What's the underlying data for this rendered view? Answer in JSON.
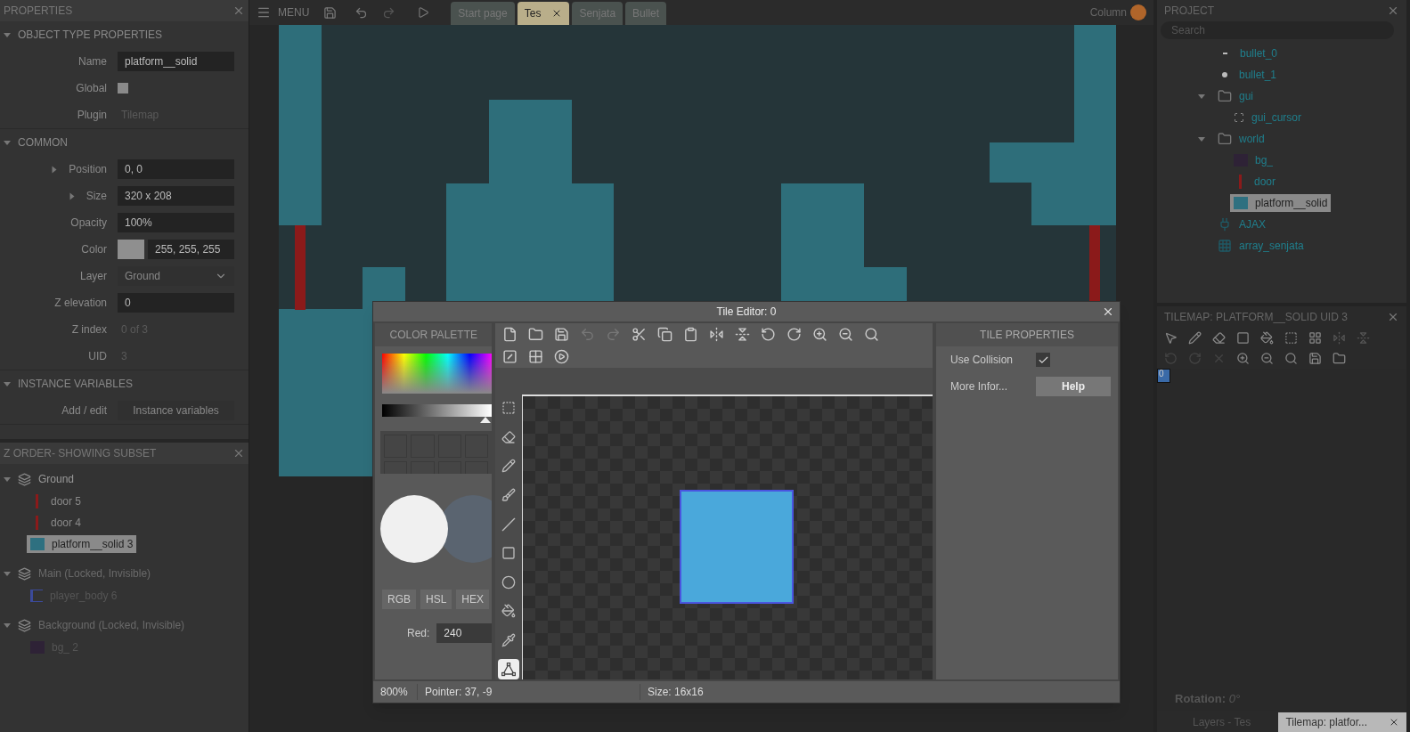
{
  "top_bar": {
    "menu": "MENU",
    "tabs": [
      {
        "label": "Start page",
        "selected": false,
        "closable": false
      },
      {
        "label": "Tes",
        "selected": true,
        "closable": true
      },
      {
        "label": "Senjata",
        "selected": false,
        "closable": false
      },
      {
        "label": "Bullet",
        "selected": false,
        "closable": false
      }
    ],
    "user": "Column"
  },
  "properties_panel": {
    "title": "PROPERTIES",
    "sections": [
      {
        "title": "OBJECT TYPE PROPERTIES",
        "expanded": true,
        "rows": [
          {
            "kind": "text",
            "label": "Name",
            "value": "platform__solid"
          },
          {
            "kind": "checkbox",
            "label": "Global",
            "checked": false
          },
          {
            "kind": "readonly",
            "label": "Plugin",
            "value": "Tilemap"
          }
        ]
      },
      {
        "title": "COMMON",
        "expanded": true,
        "rows": [
          {
            "kind": "group",
            "label": "Position",
            "value": "0, 0"
          },
          {
            "kind": "group",
            "label": "Size",
            "value": "320 x 208"
          },
          {
            "kind": "text",
            "label": "Opacity",
            "value": "100%"
          },
          {
            "kind": "color",
            "label": "Color",
            "value": "255, 255, 255"
          },
          {
            "kind": "select",
            "label": "Layer",
            "value": "Ground"
          },
          {
            "kind": "text",
            "label": "Z elevation",
            "value": "0"
          },
          {
            "kind": "readonly",
            "label": "Z index",
            "value": "0 of 3"
          },
          {
            "kind": "readonly",
            "label": "UID",
            "value": "3"
          }
        ]
      },
      {
        "title": "INSTANCE VARIABLES",
        "expanded": true,
        "rows": [
          {
            "kind": "button",
            "label": "Add / edit",
            "value": "Instance variables"
          }
        ]
      }
    ]
  },
  "z_order": {
    "title": "Z ORDER- SHOWING SUBSET",
    "layers": [
      {
        "name": "Ground",
        "disabled": false,
        "children": [
          {
            "label": "door 5",
            "kind": "bar",
            "color": "#8b1a1a",
            "selected": false
          },
          {
            "label": "door 4",
            "kind": "bar",
            "color": "#8b1a1a",
            "selected": false
          },
          {
            "label": "platform__solid 3",
            "kind": "swatch",
            "color": "#2e7080",
            "selected": true
          }
        ]
      },
      {
        "name": "Main (Locked, Invisible)",
        "disabled": true,
        "children": [
          {
            "label": "player_body 6",
            "kind": "figure",
            "selected": false
          }
        ]
      },
      {
        "name": "Background (Locked, Invisible)",
        "disabled": true,
        "children": [
          {
            "label": "bg_ 2",
            "kind": "swatch",
            "color": "#2e2236",
            "selected": false
          }
        ]
      }
    ]
  },
  "tile_editor": {
    "title": "Tile Editor: 0",
    "palette": {
      "title": "COLOR PALETTE",
      "brightness": {
        "level": 1
      },
      "modes": [
        "RGB",
        "HSL",
        "HEX"
      ],
      "channel": {
        "label": "Red:",
        "value": "240"
      }
    },
    "tools": [
      {
        "kind": "marquee",
        "selected": false
      },
      {
        "kind": "eraser",
        "selected": false
      },
      {
        "kind": "pencil",
        "selected": false
      },
      {
        "kind": "brush",
        "selected": false
      },
      {
        "kind": "line",
        "selected": false
      },
      {
        "kind": "rectangle",
        "selected": false
      },
      {
        "kind": "ellipse",
        "selected": false
      },
      {
        "kind": "fill",
        "selected": false
      },
      {
        "kind": "picker",
        "selected": false
      },
      {
        "kind": "polygon",
        "selected": true
      }
    ],
    "properties": {
      "title": "TILE PROPERTIES",
      "rows": [
        {
          "kind": "checkbox",
          "label": "Use Collision",
          "checked": true
        },
        {
          "kind": "button",
          "label": "More Infor...",
          "value": "Help"
        }
      ]
    },
    "status": [
      "800%",
      "Pointer: 37, -9",
      "Size: 16x16"
    ]
  },
  "project": {
    "title": "PROJECT",
    "search": {
      "placeholder": "Search"
    },
    "items": [
      {
        "label": "bullet_0",
        "kind": "dash",
        "selected": false
      },
      {
        "label": "bullet_1",
        "kind": "dot",
        "selected": false
      },
      {
        "label": "gui",
        "kind": "folder",
        "expanded": true,
        "selected": false,
        "children": [
          {
            "label": "gui_cursor",
            "kind": "cursor",
            "selected": false
          }
        ]
      },
      {
        "label": "world",
        "kind": "folder",
        "expanded": true,
        "selected": false,
        "children": [
          {
            "label": "bg_",
            "kind": "swatch",
            "color": "#2e2236",
            "selected": false
          },
          {
            "label": "door",
            "kind": "bar",
            "color": "#8b1a1a",
            "selected": false
          },
          {
            "label": "platform__solid",
            "kind": "swatch",
            "color": "#2e7080",
            "selected": true
          }
        ]
      },
      {
        "label": "AJAX",
        "kind": "plugin",
        "selected": false
      },
      {
        "label": "array_senjata",
        "kind": "array",
        "selected": false
      }
    ]
  },
  "tilemap_panel": {
    "title": "TILEMAP: PLATFORM__SOLID UID 3",
    "tiles": [
      {
        "label": "0",
        "selected": true
      }
    ],
    "rotation": "**Rotation:** *0°*"
  },
  "bottom_tabs": [
    {
      "label": "Layers - Tes",
      "selected": false,
      "closable": false
    },
    {
      "label": "Tilemap: platfor...",
      "selected": true,
      "closable": true
    }
  ]
}
